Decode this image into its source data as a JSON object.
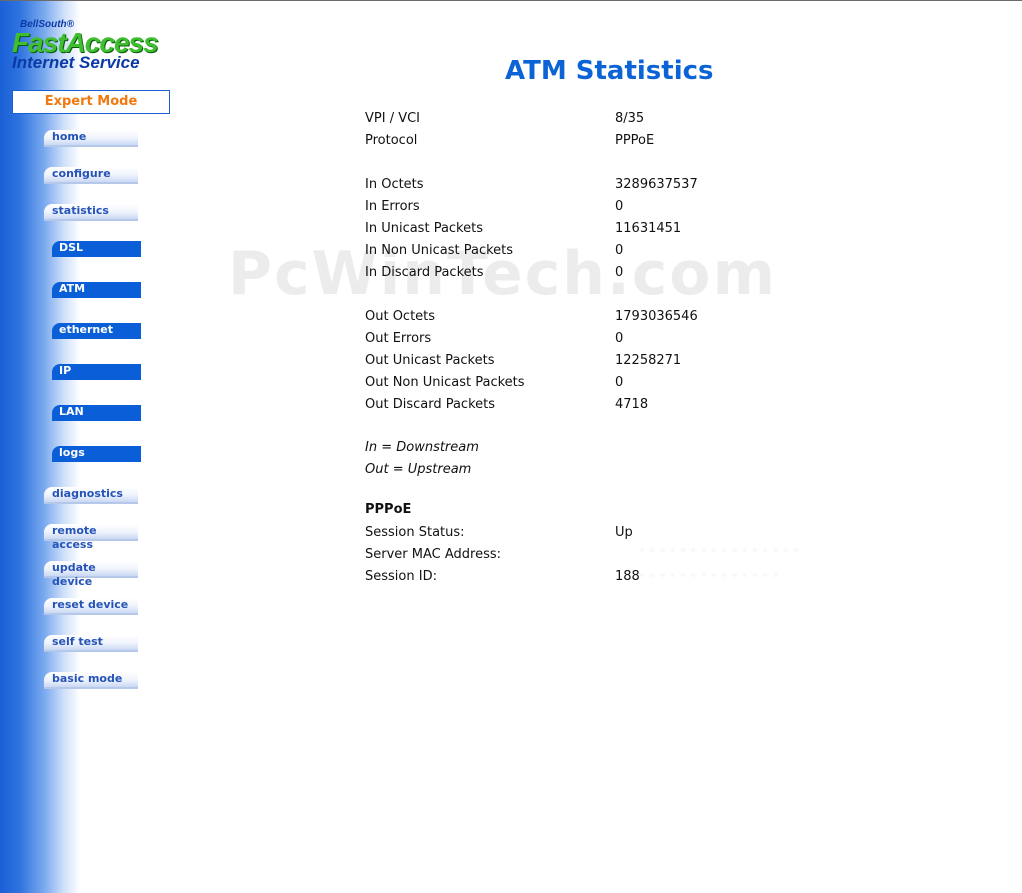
{
  "logo": {
    "line1": "BellSouth®",
    "line2": "FastAccess",
    "line3": "Internet Service"
  },
  "mode": "Expert Mode",
  "nav": {
    "home": "home",
    "configure": "configure",
    "statistics": "statistics",
    "dsl": "DSL",
    "atm": "ATM",
    "ethernet": "ethernet",
    "ip": "IP",
    "lan": "LAN",
    "logs": "logs",
    "diagnostics": "diagnostics",
    "remote_access": "remote access",
    "update_device": "update device",
    "reset_device": "reset device",
    "self_test": "self test",
    "basic_mode": "basic mode"
  },
  "page_title": "ATM Statistics",
  "watermark": "PcWinTech.com",
  "stats": [
    {
      "label": "VPI / VCI",
      "value": "8/35"
    },
    {
      "label": "Protocol",
      "value": "PPPoE"
    },
    {
      "label": "In Octets",
      "value": "3289637537"
    },
    {
      "label": "In Errors",
      "value": "0"
    },
    {
      "label": "In Unicast Packets",
      "value": "11631451"
    },
    {
      "label": "In Non Unicast Packets",
      "value": "0"
    },
    {
      "label": "In Discard Packets",
      "value": "0"
    },
    {
      "label": "Out Octets",
      "value": "1793036546"
    },
    {
      "label": "Out Errors",
      "value": "0"
    },
    {
      "label": "Out Unicast Packets",
      "value": "12258271"
    },
    {
      "label": "Out Non Unicast Packets",
      "value": "0"
    },
    {
      "label": "Out Discard Packets",
      "value": "4718"
    }
  ],
  "notes": {
    "in": "In = Downstream",
    "out": "Out = Upstream"
  },
  "pppoe": {
    "heading": "PPPoE",
    "session_status_label": "Session Status:",
    "session_status_value": "Up",
    "server_mac_label": "Server MAC Address:",
    "session_id_label": "Session ID:",
    "session_id_value": "188"
  }
}
